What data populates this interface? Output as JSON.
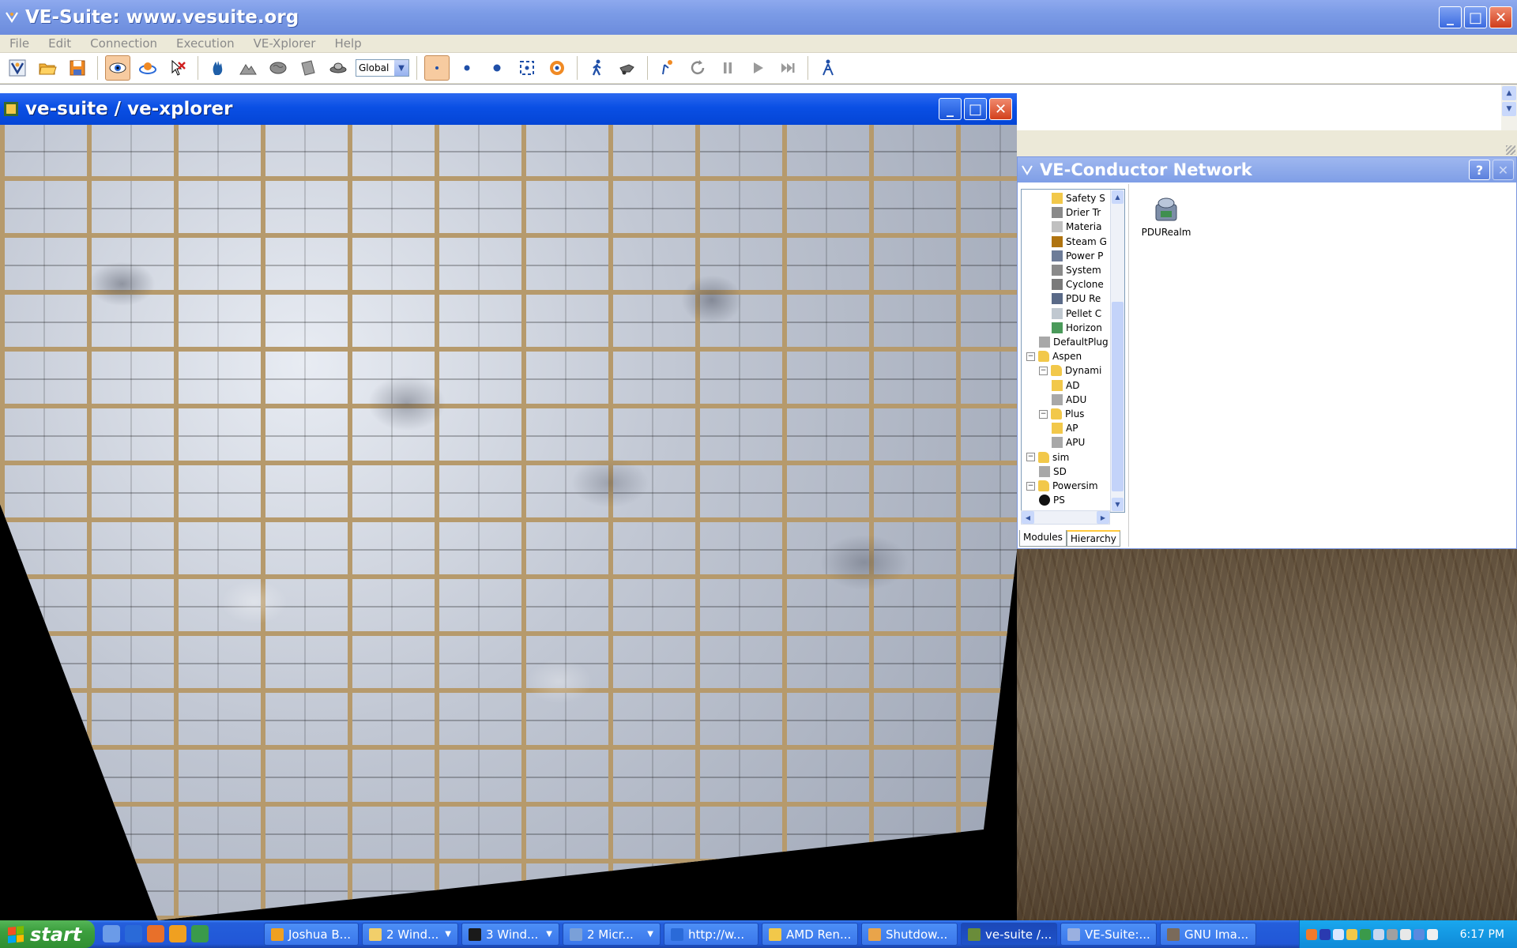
{
  "main_window": {
    "title": "VE-Suite: www.vesuite.org",
    "menu": [
      "File",
      "Edit",
      "Connection",
      "Execution",
      "VE-Xplorer",
      "Help"
    ],
    "coordinate_mode": "Global",
    "toolbar_icons": [
      "ves-logo-icon",
      "open-folder-icon",
      "save-icon",
      "eye-nav-icon",
      "orbit-icon",
      "cancel-select-icon",
      "hand-icon",
      "mountain-icon",
      "brain-icon",
      "hand-paper-icon",
      "ufo-icon",
      "point-small-icon",
      "point-medium-icon",
      "point-large-icon",
      "select-box-icon",
      "target-ring-icon",
      "walk-icon",
      "tractor-icon",
      "physics-icon",
      "reset-icon",
      "pause-icon",
      "play-icon",
      "step-icon",
      "characters-icon"
    ]
  },
  "xplorer_window": {
    "title": "ve-suite / ve-xplorer"
  },
  "conductor": {
    "title": "VE-Conductor Network",
    "tree": [
      {
        "label": "Safety S",
        "indent": 2,
        "icon": "safety"
      },
      {
        "label": "Drier Tr",
        "indent": 2,
        "icon": "drier"
      },
      {
        "label": "Materia",
        "indent": 2,
        "icon": "material"
      },
      {
        "label": "Steam G",
        "indent": 2,
        "icon": "steam"
      },
      {
        "label": "Power P",
        "indent": 2,
        "icon": "power"
      },
      {
        "label": "System",
        "indent": 2,
        "icon": "system"
      },
      {
        "label": "Cyclone",
        "indent": 2,
        "icon": "cyclone"
      },
      {
        "label": "PDU Re",
        "indent": 2,
        "icon": "pdu"
      },
      {
        "label": "Pellet C",
        "indent": 2,
        "icon": "pellet"
      },
      {
        "label": "Horizon",
        "indent": 2,
        "icon": "horizon"
      },
      {
        "label": "DefaultPlug",
        "indent": 1,
        "icon": "default"
      },
      {
        "label": "Aspen",
        "indent": 0,
        "icon": "folder",
        "expander": "−"
      },
      {
        "label": "Dynami",
        "indent": 1,
        "icon": "folder",
        "expander": "−"
      },
      {
        "label": "AD",
        "indent": 2,
        "icon": "ad"
      },
      {
        "label": "ADU",
        "indent": 2,
        "icon": "default"
      },
      {
        "label": "Plus",
        "indent": 1,
        "icon": "folder",
        "expander": "−"
      },
      {
        "label": "AP",
        "indent": 2,
        "icon": "ap"
      },
      {
        "label": "APU",
        "indent": 2,
        "icon": "default"
      },
      {
        "label": "sim",
        "indent": 0,
        "icon": "folder",
        "expander": "−"
      },
      {
        "label": "SD",
        "indent": 1,
        "icon": "default"
      },
      {
        "label": "Powersim",
        "indent": 0,
        "icon": "folder",
        "expander": "−"
      },
      {
        "label": "PS",
        "indent": 1,
        "icon": "ps"
      }
    ],
    "tabs": [
      "Modules",
      "Hierarchy"
    ],
    "active_tab": "Hierarchy",
    "network_module": "PDURealm"
  },
  "taskbar": {
    "start_label": "start",
    "tasks": [
      {
        "label": "Joshua B...",
        "icon_color": "#f0a020",
        "dropdown": false
      },
      {
        "label": "2 Wind...",
        "icon_color": "#f2cf6a",
        "dropdown": true
      },
      {
        "label": "3 Wind...",
        "icon_color": "#1a1a1a",
        "dropdown": true
      },
      {
        "label": "2 Micr...",
        "icon_color": "#7aa0d8",
        "dropdown": true
      },
      {
        "label": "http://w...",
        "icon_color": "#2a6ad8",
        "dropdown": false
      },
      {
        "label": "AMD Ren...",
        "icon_color": "#f2c84a",
        "dropdown": false
      },
      {
        "label": "Shutdow...",
        "icon_color": "#e9a44a",
        "dropdown": false
      },
      {
        "label": "ve-suite /...",
        "icon_color": "#6a8c3a",
        "dropdown": false,
        "active": true
      },
      {
        "label": "VE-Suite:...",
        "icon_color": "#9ab0e0",
        "dropdown": false
      },
      {
        "label": "GNU Ima...",
        "icon_color": "#7a6a5a",
        "dropdown": false
      }
    ],
    "clock": "6:17 PM"
  },
  "colors": {
    "xp_blue": "#245edb",
    "start_green": "#3c9f3e",
    "tray_blue": "#0f8ad8",
    "pressed_tool": "#f7cba0"
  }
}
